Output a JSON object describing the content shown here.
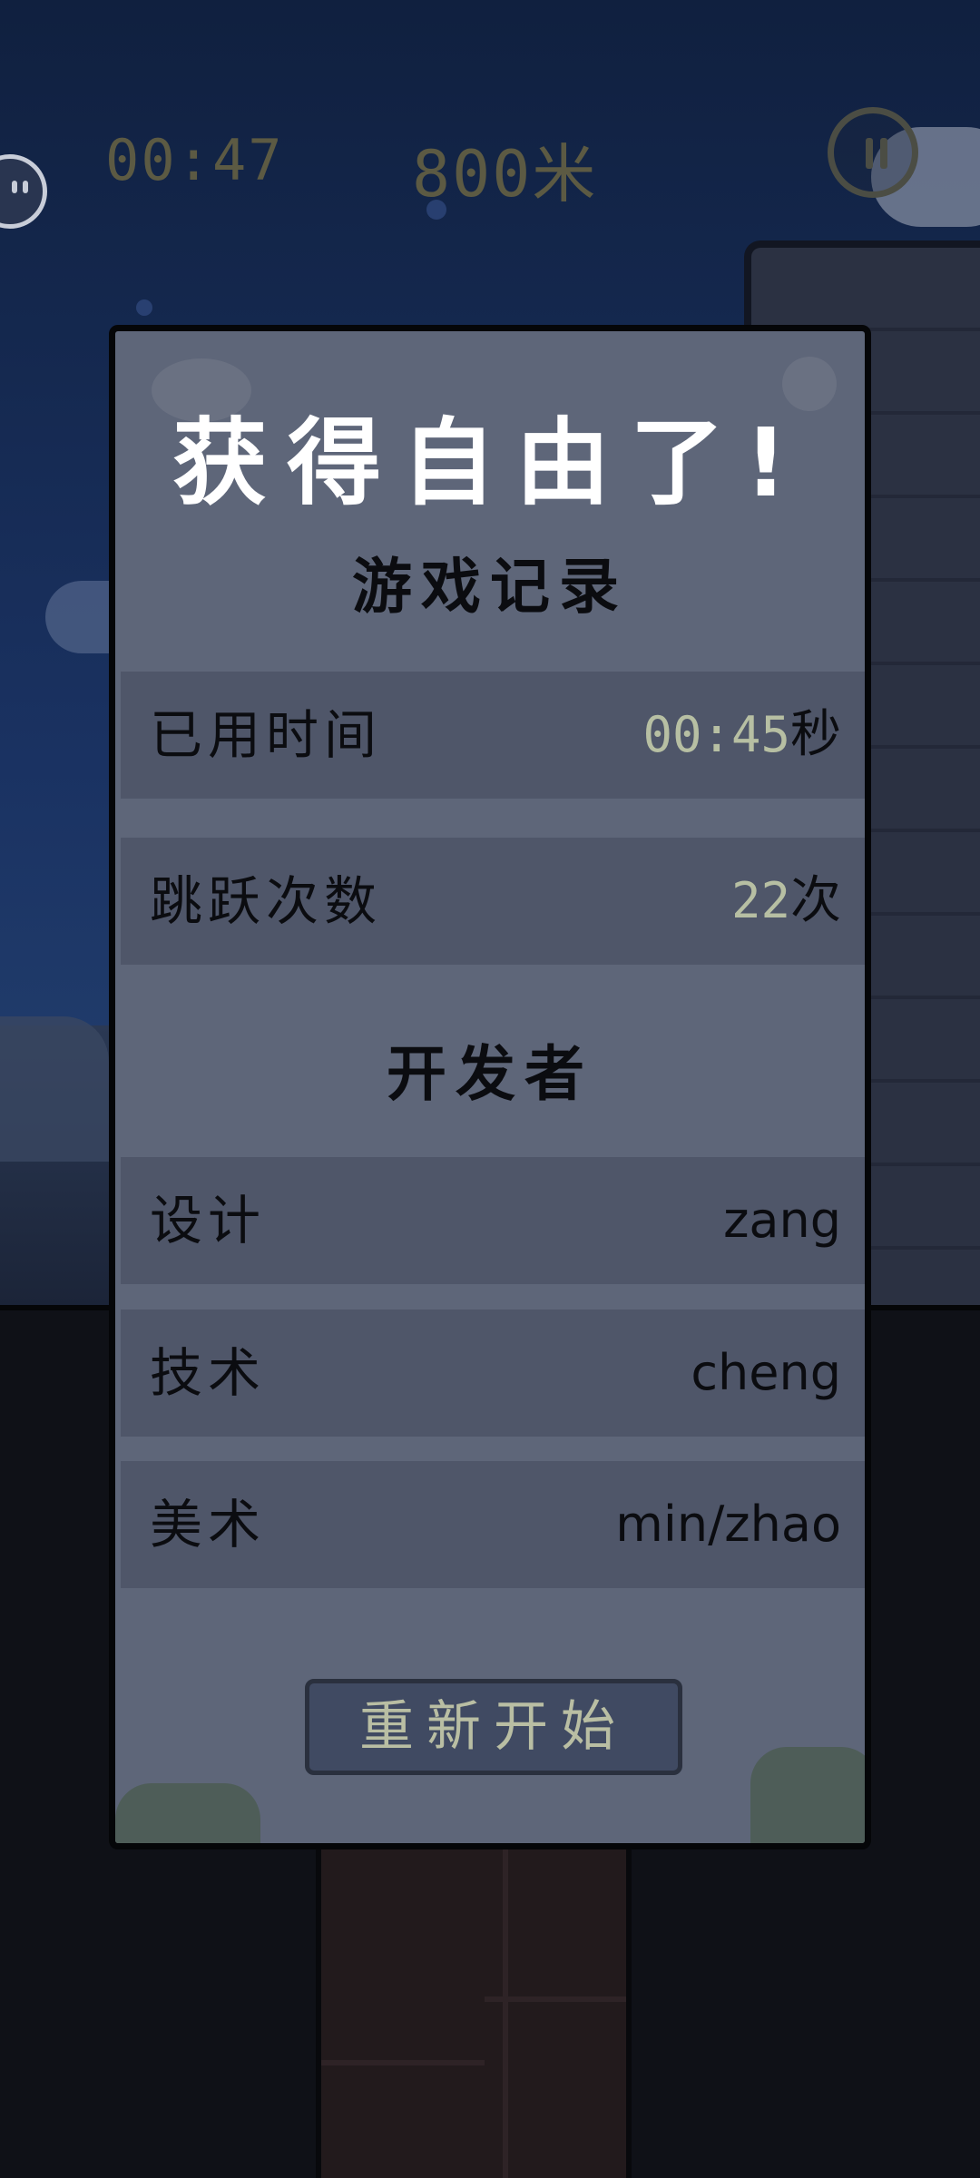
{
  "hud": {
    "timer": "00:47",
    "distance": "800米"
  },
  "dialog": {
    "title": "获得自由了!",
    "record_section": "游戏记录",
    "records": [
      {
        "label": "已用时间",
        "value": "00:45",
        "unit": "秒"
      },
      {
        "label": "跳跃次数",
        "value": "22",
        "unit": "次"
      }
    ],
    "developer_section": "开发者",
    "developers": [
      {
        "role": "设计",
        "name": "zang"
      },
      {
        "role": "技术",
        "name": "cheng"
      },
      {
        "role": "美术",
        "name": "min/zhao"
      }
    ],
    "restart_label": "重新开始"
  },
  "icons": {
    "pause": "pause-icon",
    "ghost": "ghost-face-icon"
  },
  "colors": {
    "dialog_bg": "#5e6679",
    "row_bg": "#4f5669",
    "value_accent": "#b7bfa3",
    "hud_text": "#5c5a43"
  }
}
